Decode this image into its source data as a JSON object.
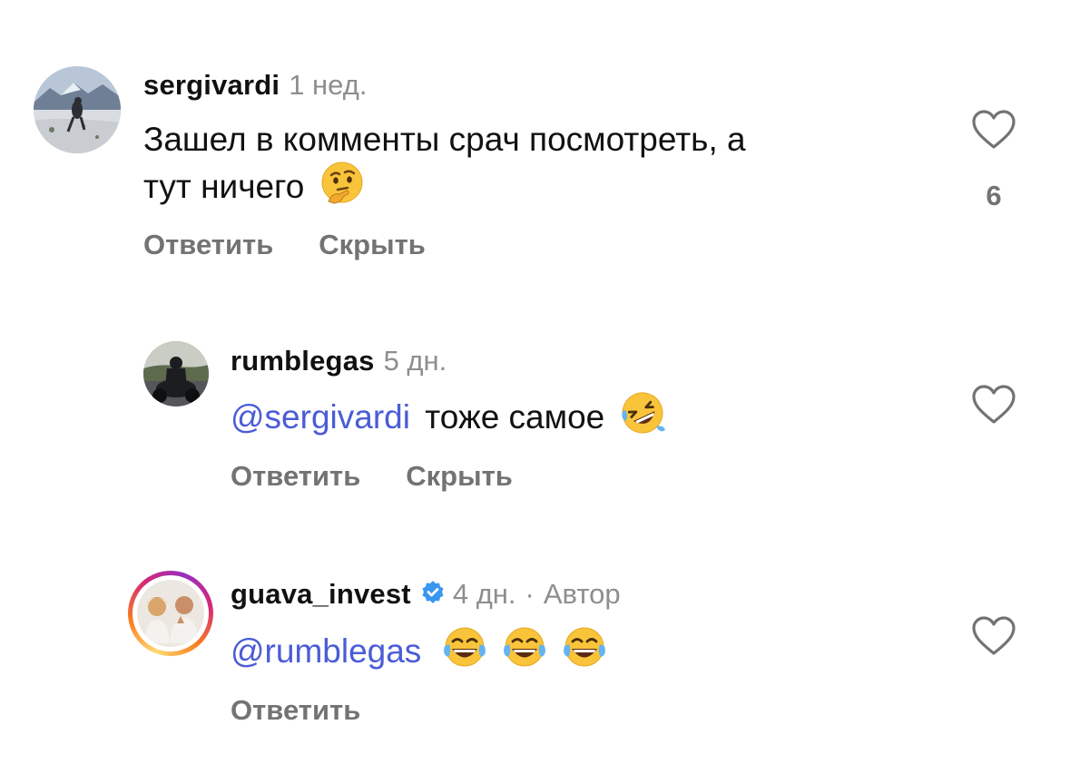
{
  "comments": [
    {
      "username": "sergivardi",
      "time": "1 нед.",
      "text_line1": "Зашел в комменты срач посмотреть, а",
      "text_line2": "тут ничего",
      "emoji": "thinking-face",
      "likes": "6",
      "actions": [
        "Ответить",
        "Скрыть"
      ]
    },
    {
      "username": "rumblegas",
      "time": "5 дн.",
      "mention": "@sergivardi",
      "text": "тоже самое",
      "emoji": "rolling-on-floor-laughing",
      "actions": [
        "Ответить",
        "Скрыть"
      ]
    },
    {
      "username": "guava_invest",
      "verified": true,
      "time": "4 дн.",
      "separator": "·",
      "author_label": "Автор",
      "mention": "@rumblegas",
      "emoji": "face-with-tears-of-joy",
      "emoji_count": 3,
      "actions": [
        "Ответить"
      ]
    }
  ],
  "colors": {
    "mention": "#4a5cd6",
    "secondary": "#737373",
    "verified": "#3897f0"
  }
}
